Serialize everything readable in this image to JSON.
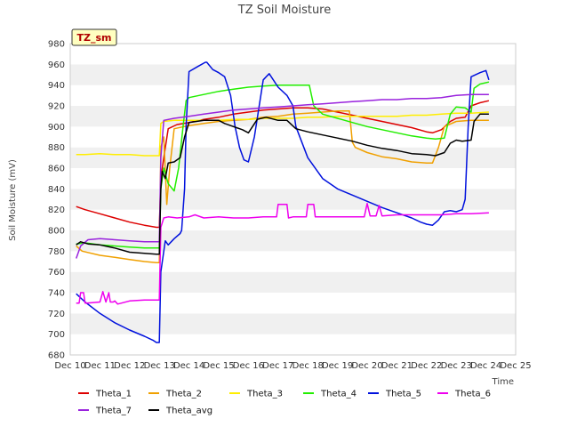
{
  "chart_data": {
    "type": "line",
    "title": "TZ Soil Moisture",
    "xlabel": "Time",
    "ylabel": "Soil Moisture (mV)",
    "badge": "TZ_sm",
    "x_range": [
      10,
      25
    ],
    "ylim": [
      680,
      980
    ],
    "y_ticks": [
      680,
      700,
      720,
      740,
      760,
      780,
      800,
      820,
      840,
      860,
      880,
      900,
      920,
      940,
      960,
      980
    ],
    "x_ticks": [
      {
        "value": 10,
        "label": "Dec 10"
      },
      {
        "value": 11,
        "label": "Dec 11"
      },
      {
        "value": 12,
        "label": "Dec 12"
      },
      {
        "value": 13,
        "label": "Dec 13"
      },
      {
        "value": 14,
        "label": "Dec 14"
      },
      {
        "value": 15,
        "label": "Dec 15"
      },
      {
        "value": 16,
        "label": "Dec 16"
      },
      {
        "value": 17,
        "label": "Dec 17"
      },
      {
        "value": 18,
        "label": "Dec 18"
      },
      {
        "value": 19,
        "label": "Dec 19"
      },
      {
        "value": 20,
        "label": "Dec 20"
      },
      {
        "value": 21,
        "label": "Dec 21"
      },
      {
        "value": 22,
        "label": "Dec 22"
      },
      {
        "value": 23,
        "label": "Dec 23"
      },
      {
        "value": 24,
        "label": "Dec 24"
      },
      {
        "value": 25,
        "label": "Dec 25"
      }
    ],
    "grid": "horizontal bands",
    "legend_position": "bottom",
    "series": [
      {
        "name": "Theta_1",
        "color": "#dd0000",
        "x": [
          10.2,
          10.5,
          11,
          11.5,
          12,
          12.5,
          12.9,
          13.0,
          13.05,
          13.15,
          13.3,
          13.6,
          14,
          14.5,
          15,
          15.5,
          16,
          16.5,
          17,
          17.5,
          18,
          18.5,
          19,
          19.5,
          20,
          20.5,
          21,
          21.5,
          22,
          22.2,
          22.5,
          22.8,
          23,
          23.3,
          23.5,
          23.8,
          24.1
        ],
        "y": [
          823,
          820,
          816,
          812,
          808,
          805,
          803,
          803,
          850,
          870,
          898,
          902,
          904,
          907,
          909,
          912,
          914,
          916,
          917,
          918,
          918,
          917,
          914,
          911,
          908,
          905,
          902,
          899,
          895,
          894,
          897,
          905,
          908,
          909,
          920,
          923,
          925
        ]
      },
      {
        "name": "Theta_2",
        "color": "#f0a000",
        "x": [
          10.2,
          10.4,
          11,
          11.5,
          12,
          12.5,
          12.9,
          13.0,
          13.05,
          13.15,
          13.25,
          13.35,
          13.5,
          14,
          14.5,
          15,
          15.5,
          16,
          16.5,
          17,
          17.5,
          18,
          18.5,
          19,
          19.4,
          19.5,
          19.6,
          20,
          20.5,
          21,
          21.5,
          22,
          22.2,
          22.4,
          22.6,
          23,
          23.5,
          24.1
        ],
        "y": [
          785,
          780,
          776,
          774,
          772,
          770,
          769,
          769,
          880,
          890,
          825,
          860,
          898,
          901,
          903,
          905,
          906,
          907,
          909,
          910,
          912,
          913,
          914,
          915,
          915,
          885,
          880,
          875,
          871,
          869,
          866,
          865,
          865,
          880,
          900,
          905,
          906,
          906
        ]
      },
      {
        "name": "Theta_3",
        "color": "#ffee00",
        "x": [
          10.2,
          10.5,
          11,
          11.5,
          12,
          12.5,
          12.9,
          13.0,
          13.05,
          13.15,
          13.5,
          14,
          14.5,
          15,
          15.5,
          16,
          16.5,
          17,
          17.5,
          18,
          18.5,
          19,
          19.5,
          20,
          20.5,
          21,
          21.5,
          22,
          22.5,
          23,
          23.5,
          24.1
        ],
        "y": [
          873,
          873,
          874,
          873,
          873,
          872,
          872,
          872,
          903,
          905,
          906,
          906,
          906,
          906,
          907,
          907,
          908,
          908,
          908,
          909,
          909,
          910,
          910,
          910,
          910,
          910,
          911,
          911,
          912,
          913,
          913,
          914
        ]
      },
      {
        "name": "Theta_4",
        "color": "#22ee00",
        "x": [
          10.2,
          10.5,
          11,
          11.5,
          12,
          12.5,
          12.9,
          13.0,
          13.05,
          13.15,
          13.3,
          13.5,
          13.65,
          13.8,
          13.9,
          14,
          14.5,
          15,
          15.5,
          16,
          16.5,
          17,
          17.5,
          18,
          18.05,
          18.2,
          18.5,
          19,
          19.5,
          20,
          20.5,
          21,
          21.5,
          22,
          22.3,
          22.6,
          22.8,
          23,
          23.3,
          23.5,
          23.6,
          23.8,
          24.1
        ],
        "y": [
          787,
          788,
          786,
          785,
          784,
          783,
          783,
          783,
          840,
          860,
          845,
          838,
          860,
          900,
          925,
          928,
          931,
          934,
          936,
          938,
          939,
          940,
          940,
          940,
          940,
          920,
          912,
          908,
          904,
          900,
          897,
          894,
          891,
          889,
          888,
          889,
          912,
          919,
          918,
          914,
          937,
          941,
          943
        ]
      },
      {
        "name": "Theta_5",
        "color": "#0011dd",
        "x": [
          10.2,
          10.5,
          11,
          11.5,
          12,
          12.5,
          12.8,
          12.9,
          13.0,
          13.05,
          13.2,
          13.3,
          13.5,
          13.7,
          13.75,
          13.85,
          13.9,
          14,
          14.3,
          14.55,
          14.6,
          14.8,
          15,
          15.2,
          15.4,
          15.55,
          15.7,
          15.85,
          16,
          16.2,
          16.5,
          16.6,
          16.7,
          17,
          17.3,
          17.5,
          17.6,
          18,
          18.5,
          19,
          19.5,
          20,
          20.5,
          21,
          21.5,
          21.8,
          22,
          22.2,
          22.4,
          22.6,
          22.8,
          23,
          23.2,
          23.3,
          23.4,
          23.5,
          23.8,
          24.0,
          24.1
        ],
        "y": [
          739,
          731,
          720,
          711,
          704,
          698,
          694,
          692,
          692,
          760,
          790,
          786,
          792,
          797,
          800,
          840,
          900,
          953,
          958,
          962,
          962,
          955,
          952,
          948,
          930,
          900,
          880,
          868,
          866,
          890,
          945,
          948,
          951,
          938,
          930,
          920,
          900,
          870,
          850,
          840,
          834,
          828,
          822,
          817,
          812,
          808,
          806,
          805,
          810,
          818,
          819,
          818,
          820,
          830,
          900,
          948,
          952,
          954,
          945
        ]
      },
      {
        "name": "Theta_6",
        "color": "#ee00ee",
        "x": [
          10.2,
          10.3,
          10.35,
          10.45,
          10.5,
          10.55,
          11,
          11.1,
          11.2,
          11.3,
          11.35,
          11.45,
          11.5,
          11.6,
          12,
          12.5,
          12.9,
          13.0,
          13.05,
          13.15,
          13.3,
          13.6,
          14,
          14.2,
          14.5,
          15,
          15.5,
          16,
          16.5,
          16.95,
          17.0,
          17.3,
          17.35,
          17.5,
          17.7,
          17.95,
          18.0,
          18.2,
          18.25,
          18.5,
          19,
          19.5,
          19.9,
          20.0,
          20.1,
          20.3,
          20.4,
          20.5,
          21,
          21.5,
          22,
          22.5,
          23,
          23.5,
          24.1
        ],
        "y": [
          730,
          730,
          740,
          740,
          730,
          730,
          731,
          741,
          731,
          740,
          731,
          731,
          732,
          729,
          732,
          733,
          733,
          733,
          803,
          812,
          813,
          812,
          813,
          815,
          812,
          813,
          812,
          812,
          813,
          813,
          825,
          825,
          812,
          813,
          813,
          813,
          825,
          825,
          813,
          813,
          813,
          813,
          813,
          826,
          814,
          814,
          824,
          814,
          815,
          815,
          815,
          815,
          816,
          816,
          817
        ]
      },
      {
        "name": "Theta_7",
        "color": "#9922dd",
        "x": [
          10.2,
          10.35,
          10.6,
          11,
          11.5,
          12,
          12.5,
          12.9,
          13.0,
          13.05,
          13.15,
          13.5,
          14,
          14.5,
          15,
          15.5,
          16,
          16.5,
          17,
          17.5,
          18,
          18.5,
          19,
          19.5,
          20,
          20.5,
          21,
          21.5,
          22,
          22.5,
          23,
          23.5,
          24.1
        ],
        "y": [
          773,
          785,
          791,
          792,
          791,
          790,
          789,
          789,
          789,
          870,
          906,
          908,
          910,
          912,
          914,
          916,
          917,
          918,
          919,
          920,
          921,
          922,
          923,
          924,
          925,
          926,
          926,
          927,
          927,
          928,
          930,
          931,
          931
        ]
      },
      {
        "name": "Theta_avg",
        "color": "#000000",
        "x": [
          10.2,
          10.35,
          10.6,
          11,
          11.5,
          12,
          12.5,
          12.9,
          13.0,
          13.05,
          13.1,
          13.2,
          13.3,
          13.5,
          13.7,
          13.85,
          14,
          14.5,
          15,
          15.2,
          15.4,
          15.6,
          15.8,
          16,
          16.3,
          16.6,
          17,
          17.3,
          17.6,
          18,
          18.5,
          19,
          19.5,
          20,
          20.5,
          21,
          21.5,
          22,
          22.3,
          22.6,
          22.8,
          23,
          23.2,
          23.5,
          23.6,
          23.8,
          24.1
        ],
        "y": [
          786,
          789,
          787,
          786,
          783,
          779,
          778,
          777,
          777,
          840,
          857,
          850,
          865,
          866,
          870,
          890,
          904,
          906,
          906,
          903,
          901,
          899,
          897,
          894,
          907,
          909,
          906,
          906,
          898,
          895,
          892,
          889,
          886,
          882,
          879,
          877,
          874,
          873,
          872,
          875,
          884,
          887,
          886,
          887,
          905,
          912,
          912
        ]
      }
    ]
  }
}
